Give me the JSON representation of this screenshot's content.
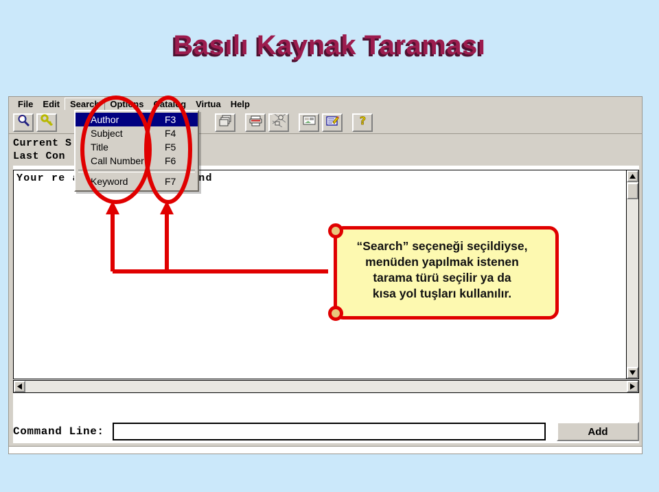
{
  "slide": {
    "title": "Basılı Kaynak Taraması",
    "background_color": "#cbe8fa",
    "title_color": "#9c1c4e",
    "title_shadow_color": "#4f1030"
  },
  "app_window": {
    "menu_bar": {
      "items": [
        {
          "label": "File",
          "state": "normal"
        },
        {
          "label": "Edit",
          "state": "normal"
        },
        {
          "label": "Search",
          "state": "open"
        },
        {
          "label": "Options",
          "state": "normal"
        },
        {
          "label": "Catalog",
          "state": "normal"
        },
        {
          "label": "Virtua",
          "state": "normal"
        },
        {
          "label": "Help",
          "state": "normal"
        }
      ]
    },
    "toolbar": {
      "buttons": [
        {
          "icon": "magnifier-icon",
          "name": "search-toolbar-button"
        },
        {
          "icon": "key-icon",
          "name": "authority-toolbar-button"
        },
        {
          "icon": "windows-stack-icon",
          "name": "windows-toolbar-button"
        },
        {
          "icon": "printer-icon",
          "name": "print-toolbar-button"
        },
        {
          "icon": "network-icon",
          "name": "network-toolbar-button"
        },
        {
          "icon": "record-card-icon",
          "name": "record-toolbar-button"
        },
        {
          "icon": "edit-record-icon",
          "name": "edit-record-toolbar-button"
        },
        {
          "icon": "question-mark-icon",
          "name": "help-toolbar-button"
        }
      ]
    },
    "dropdown": {
      "owner": "Search",
      "items": [
        {
          "label": "Author",
          "shortcut": "F3",
          "selected": true
        },
        {
          "label": "Subject",
          "shortcut": "F4",
          "selected": false
        },
        {
          "label": "Title",
          "shortcut": "F5",
          "selected": false
        },
        {
          "label": "Call Number",
          "shortcut": "F6",
          "selected": false
        },
        {
          "label": "Keyword",
          "shortcut": "F7",
          "selected": false
        }
      ],
      "separator_before_index": 4,
      "highlight_color": "#000080"
    },
    "status": {
      "line1": "Current S",
      "line2": "Last Con"
    },
    "text_pane": {
      "message": "Your re                a recognized command"
    },
    "scrollbars": {
      "vertical": {
        "up_arrow": "▲",
        "down_arrow": "▼"
      },
      "horizontal": {
        "left_arrow": "◄",
        "right_arrow": "►"
      }
    },
    "command_bar": {
      "label": "Command Line:",
      "input_value": "",
      "input_placeholder": "",
      "add_label": "Add"
    }
  },
  "annotation": {
    "callout_text_lines": [
      "“Search” seçeneği seçildiyse,",
      "menüden yapılmak istenen",
      "tarama türü seçilir ya da",
      "kısa yol tuşları kullanılır."
    ],
    "callout_text": "“Search” seçeneği seçildiyse, menüden yapılmak istenen tarama türü seçilir ya da kısa yol tuşları kullanılır.",
    "highlight_color": "#e00000",
    "callout_fill": "#fdf9b0",
    "ellipse_count": 2,
    "arrow_count": 2
  }
}
